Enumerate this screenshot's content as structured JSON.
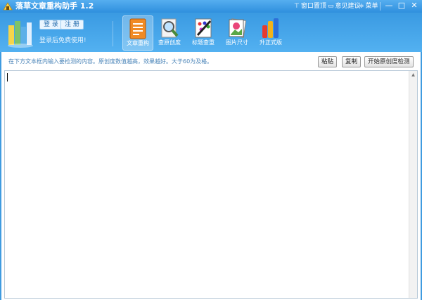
{
  "app": {
    "title": "落草文章重构助手 1.2"
  },
  "titlebar": {
    "links": [
      {
        "label": "窗口置顶",
        "icon": "pin-icon"
      },
      {
        "label": "意见建议",
        "icon": "feedback-icon"
      },
      {
        "label": "菜单",
        "icon": "menu-icon"
      }
    ],
    "window_buttons": [
      "minimize",
      "maximize",
      "close"
    ],
    "minimize_glyph": "—",
    "maximize_glyph": "□",
    "close_glyph": "✕"
  },
  "account": {
    "login_label": "登 录",
    "register_label": "注 册",
    "status": "登录后免费使用!"
  },
  "tools": [
    {
      "label": "文章重构",
      "icon": "document-icon",
      "active": true
    },
    {
      "label": "查原创度",
      "icon": "magnifier-icon",
      "active": false
    },
    {
      "label": "标题查重",
      "icon": "palette-icon",
      "active": false
    },
    {
      "label": "图片尺寸",
      "icon": "picture-icon",
      "active": false
    },
    {
      "label": "升正式版",
      "icon": "upgrade-icon",
      "active": false
    }
  ],
  "content": {
    "hint": "在下方文本框内输入要检测的内容。原创度数值越高，效果越好。大于60为及格。",
    "buttons": {
      "paste": "粘贴",
      "copy": "复制",
      "check": "开始原创度检测"
    },
    "editor_value": ""
  },
  "colors": {
    "accent": "#3f9be0",
    "hint_text": "#4a84b8"
  }
}
